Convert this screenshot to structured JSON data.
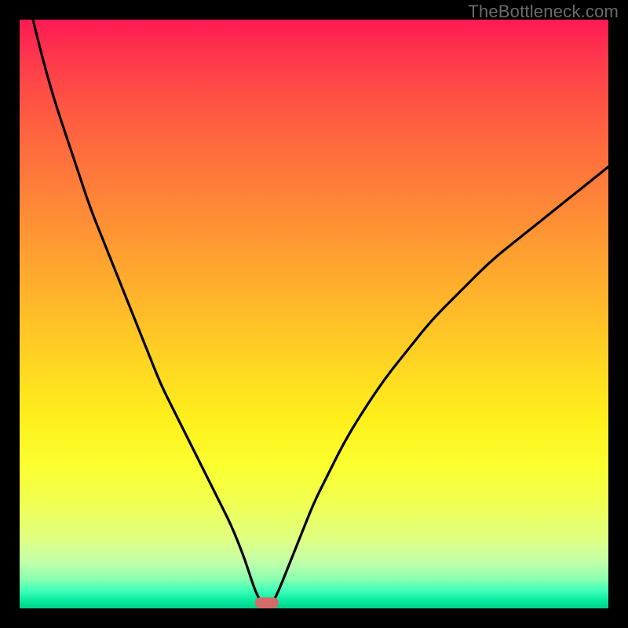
{
  "watermark": "TheBottleneck.com",
  "colors": {
    "frame": "#000000",
    "watermark": "#6b6b6b",
    "curve": "#000000",
    "marker": "#d46a6a"
  },
  "chart_data": {
    "type": "line",
    "title": "",
    "xlabel": "",
    "ylabel": "",
    "xlim": [
      0,
      100
    ],
    "ylim": [
      0,
      100
    ],
    "x": [
      0,
      2,
      4,
      6,
      8,
      10,
      12,
      14,
      16,
      18,
      20,
      22,
      24,
      26,
      28,
      30,
      32,
      34,
      36,
      38,
      39,
      40,
      41,
      42,
      43,
      44,
      46,
      48,
      50,
      52,
      55,
      58,
      62,
      66,
      70,
      75,
      80,
      85,
      90,
      95,
      100
    ],
    "values": [
      110,
      101,
      93,
      86,
      80,
      74,
      68,
      63,
      58,
      53,
      48,
      43,
      38,
      34,
      30,
      26,
      22,
      18,
      14,
      9,
      6,
      3,
      1,
      0,
      1,
      3,
      8,
      13,
      18,
      22,
      28,
      33,
      39,
      44,
      49,
      54,
      59,
      63,
      67,
      71,
      75
    ],
    "marker": {
      "x_center": 42,
      "y": 0,
      "width_frac": 0.04
    },
    "grid": false,
    "legend": false
  }
}
